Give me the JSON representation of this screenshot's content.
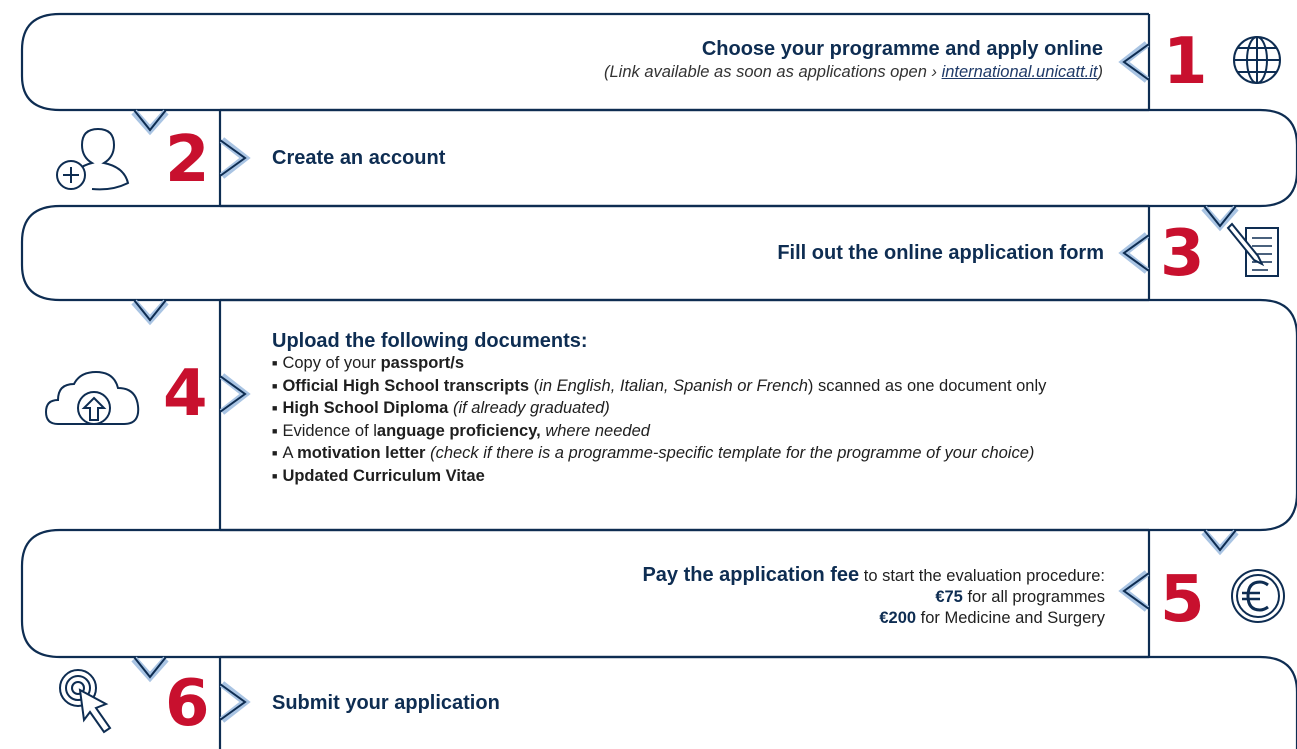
{
  "colors": {
    "navy": "#0e2d52",
    "red": "#c8102e",
    "light_blue": "#a9c4e3",
    "text": "#1f1f1f"
  },
  "steps": [
    {
      "number": "1",
      "icon": "globe-icon",
      "title": "Choose your programme and apply online",
      "note_prefix": "(Link available as soon as applications open ›",
      "link": "international.unicatt.it",
      "note_suffix": ")"
    },
    {
      "number": "2",
      "icon": "add-user-icon",
      "title": "Create an account"
    },
    {
      "number": "3",
      "icon": "form-pencil-icon",
      "title": "Fill out the online application form"
    },
    {
      "number": "4",
      "icon": "cloud-upload-icon",
      "title": "Upload the following documents:",
      "items": [
        {
          "a": "Copy of your ",
          "b": "passport/s",
          "c": "",
          "d": ""
        },
        {
          "a": "",
          "b": "Official High School transcripts",
          "c": " (",
          "d": "in English, Italian, Spanish or French",
          "e": ") scanned as one document only"
        },
        {
          "a": "",
          "b": "High School Diploma",
          "c": " ",
          "d": "(if already graduated)"
        },
        {
          "a": "Evidence of l",
          "b": "anguage proficiency,",
          "c": " ",
          "d": "where needed"
        },
        {
          "a": "A ",
          "b": "motivation letter",
          "c": " ",
          "d": "(check if there is a programme-specific template for the programme of your choice)"
        },
        {
          "a": "",
          "b": "Updated Curriculum Vitae",
          "c": "",
          "d": ""
        }
      ]
    },
    {
      "number": "5",
      "icon": "euro-coin-icon",
      "title": "Pay the application fee",
      "title_suffix": " to start the evaluation procedure:",
      "fees": [
        {
          "amount": "€75",
          "label": " for all programmes"
        },
        {
          "amount": "€200",
          "label": " for Medicine and Surgery"
        }
      ]
    },
    {
      "number": "6",
      "icon": "target-cursor-icon",
      "title": "Submit your application"
    }
  ]
}
